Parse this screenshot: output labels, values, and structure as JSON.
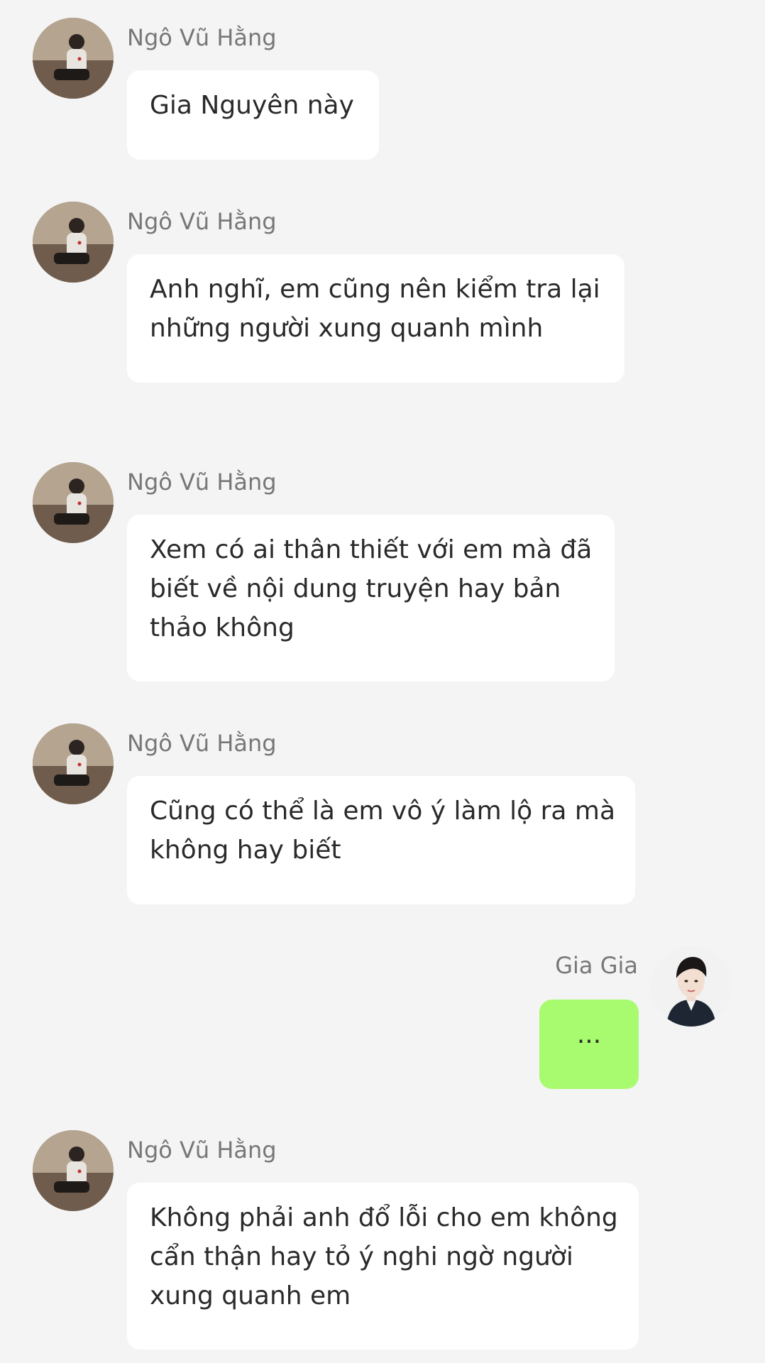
{
  "conversation": {
    "messages": [
      {
        "sender": "Ngô Vũ Hằng",
        "lines": [
          "Gia Nguyên này"
        ]
      },
      {
        "sender": "Ngô Vũ Hằng",
        "lines": [
          "Anh nghĩ, em cũng nên kiểm tra lại",
          "những người xung quanh mình"
        ]
      },
      {
        "sender": "Ngô Vũ Hằng",
        "lines": [
          "Xem có ai thân thiết với em mà đã",
          "biết về nội dung truyện hay bản",
          "thảo không"
        ]
      },
      {
        "sender": "Ngô Vũ Hằng",
        "lines": [
          "Cũng có thể là em vô ý làm lộ ra mà",
          "không hay biết"
        ]
      },
      {
        "sender": "Gia Gia",
        "lines": [
          "..."
        ]
      },
      {
        "sender": "Ngô Vũ Hằng",
        "lines": [
          "Không phải anh đổ lỗi cho em không",
          "cẩn thận hay tỏ ý nghi ngờ người",
          "xung quanh em"
        ]
      }
    ]
  },
  "colors": {
    "background": "#f4f4f4",
    "incoming_bubble": "#ffffff",
    "outgoing_bubble": "#a8fa6f",
    "sender_name": "#777777",
    "message_text": "#2a2a2a"
  }
}
